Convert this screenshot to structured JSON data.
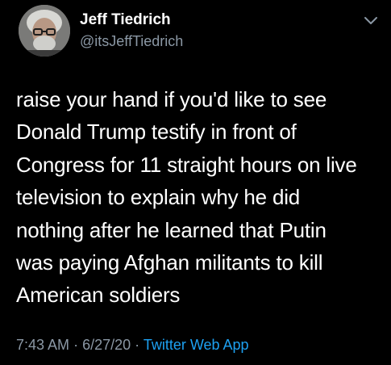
{
  "author": {
    "display_name": "Jeff Tiedrich",
    "handle": "@itsJeffTiedrich"
  },
  "tweet": {
    "lines": [
      "raise your hand if you'd like to see",
      "Donald Trump testify in front of",
      "Congress for 11 straight hours on live",
      "television to explain why he did",
      "nothing after he learned that Putin",
      "was paying Afghan militants to kill",
      "American soldiers"
    ]
  },
  "meta": {
    "time": "7:43 AM",
    "separator": "·",
    "date": "6/27/20",
    "source": "Twitter Web App"
  },
  "colors": {
    "background": "#000000",
    "text": "#ffffff",
    "secondary": "#8b98a5",
    "link": "#1da1f2"
  },
  "icons": {
    "menu": "chevron-down-icon"
  }
}
